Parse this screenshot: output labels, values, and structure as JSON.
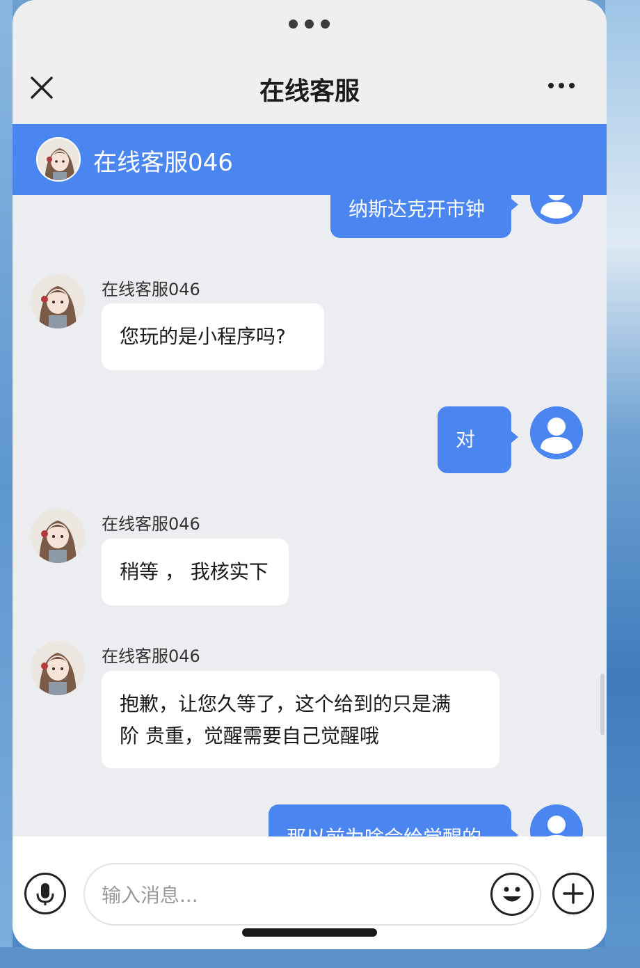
{
  "header": {
    "title": "在线客服",
    "close_icon": "close-icon",
    "more_icon": "more-horizontal-icon"
  },
  "agent": {
    "name": "在线客服046"
  },
  "messages": [
    {
      "side": "right",
      "text": "纳斯达克开市钟"
    },
    {
      "side": "left",
      "sender": "在线客服046",
      "text": "您玩的是小程序吗?"
    },
    {
      "side": "right",
      "text": "对"
    },
    {
      "side": "left",
      "sender": "在线客服046",
      "text": "稍等 ， 我核实下"
    },
    {
      "side": "left",
      "sender": "在线客服046",
      "text_line1": "抱歉，让您久等了，这个给到的只是满",
      "text_line2": "阶 贵重，觉醒需要自己觉醒哦"
    },
    {
      "side": "right",
      "text": "那以前为啥会给觉醒的"
    }
  ],
  "composer": {
    "placeholder": "输入消息...",
    "mic_icon": "microphone-icon",
    "emoji_icon": "emoji-icon",
    "plus_icon": "plus-icon"
  },
  "colors": {
    "accent": "#4a85f0",
    "chat_bg": "#ecedf0",
    "bubble_left": "#ffffff"
  }
}
